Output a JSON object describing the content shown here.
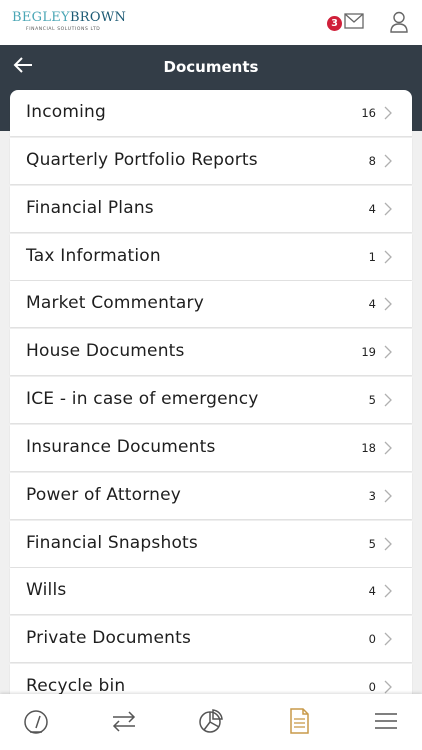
{
  "brand": {
    "name_part1": "BEGLEY",
    "name_part2": "BROWN",
    "subtitle": "FINANCIAL SOLUTIONS LTD"
  },
  "notifications": {
    "count": "3"
  },
  "header": {
    "title": "Documents"
  },
  "folders": [
    {
      "label": "Incoming",
      "count": "16"
    },
    {
      "label": "Quarterly Portfolio Reports",
      "count": "8"
    },
    {
      "label": "Financial Plans",
      "count": "4"
    },
    {
      "label": "Tax Information",
      "count": "1"
    },
    {
      "label": "Market Commentary",
      "count": "4"
    },
    {
      "label": "House Documents",
      "count": "19"
    },
    {
      "label": "ICE - in case of emergency",
      "count": "5"
    },
    {
      "label": "Insurance Documents",
      "count": "18"
    },
    {
      "label": "Power of Attorney",
      "count": "3"
    },
    {
      "label": "Financial Snapshots",
      "count": "5"
    },
    {
      "label": "Wills",
      "count": "4"
    },
    {
      "label": "Private Documents",
      "count": "0"
    },
    {
      "label": "Recycle bin",
      "count": "0"
    }
  ],
  "bottom_nav": [
    {
      "icon": "dashboard-icon"
    },
    {
      "icon": "transfer-icon"
    },
    {
      "icon": "pie-chart-icon"
    },
    {
      "icon": "document-icon",
      "active": true
    },
    {
      "icon": "menu-icon"
    }
  ],
  "colors": {
    "header_bg": "#333d47",
    "badge": "#d0203a",
    "brand_light": "#4aa6b5",
    "brand_dark": "#1c5a74",
    "active_nav": "#c89a4a"
  }
}
